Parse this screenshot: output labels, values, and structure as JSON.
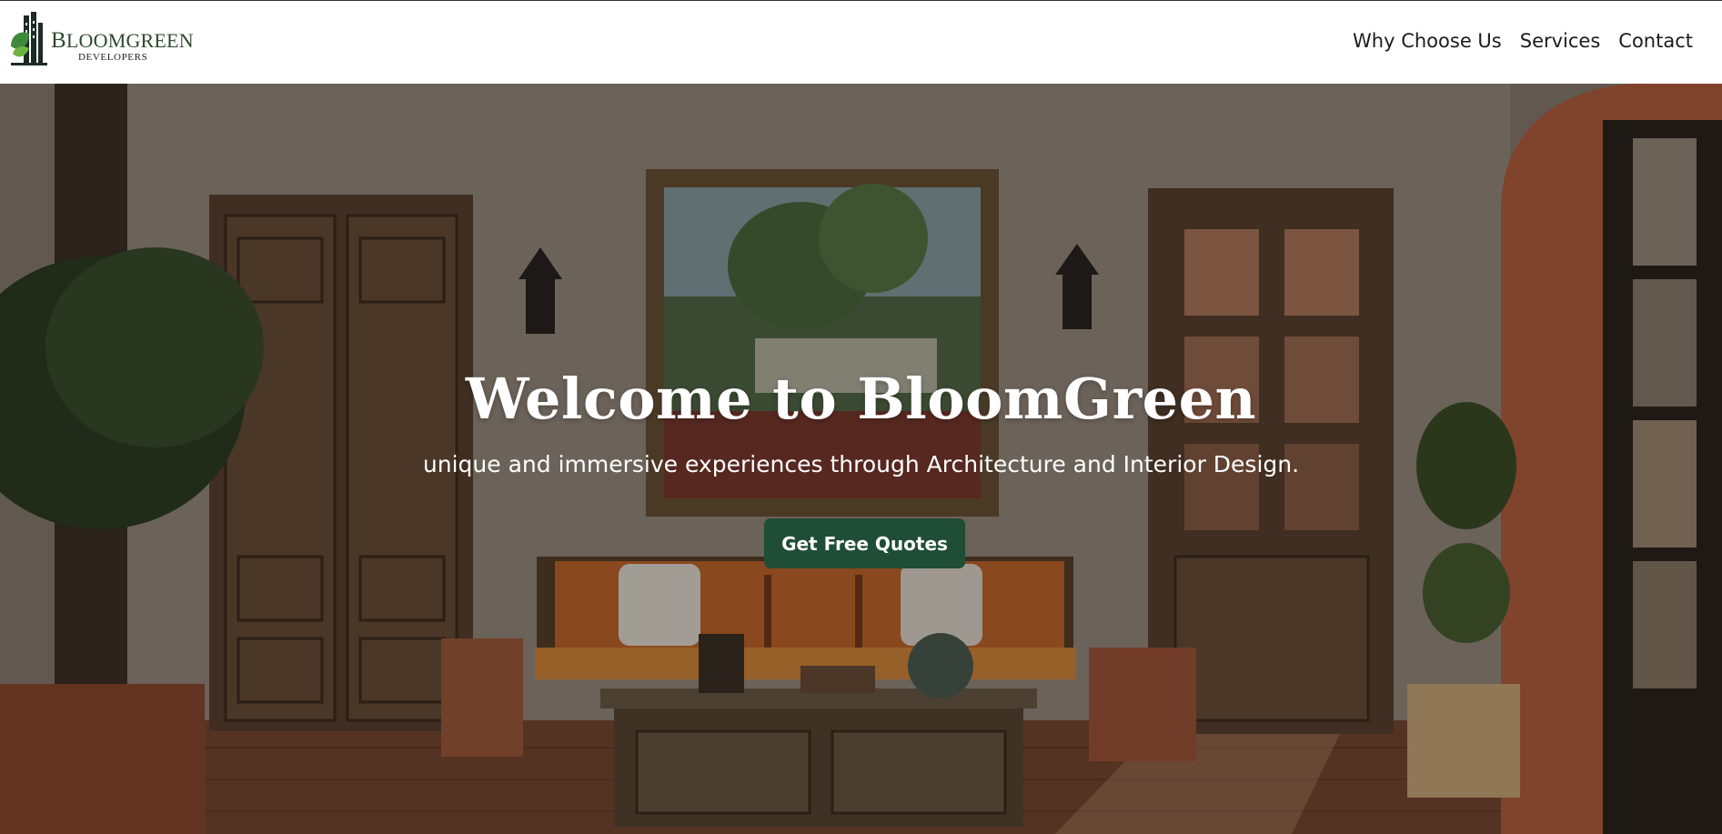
{
  "header": {
    "logo": {
      "title_lead": "B",
      "title_rest": "LOOMGREEN",
      "subtitle": "DEVELOPERS",
      "icon": "building-leaf-logo"
    },
    "nav": [
      {
        "label": "Why Choose Us"
      },
      {
        "label": "Services"
      },
      {
        "label": "Contact"
      }
    ]
  },
  "hero": {
    "title": "Welcome to BloomGreen",
    "subtitle": "unique and immersive experiences through Architecture and Interior Design.",
    "cta_label": "Get Free Quotes",
    "background_image": "interior-living-room-photo"
  },
  "colors": {
    "brand_green": "#1f4d35",
    "logo_green": "#2d4a2c",
    "nav_text": "#1c1c1c"
  }
}
